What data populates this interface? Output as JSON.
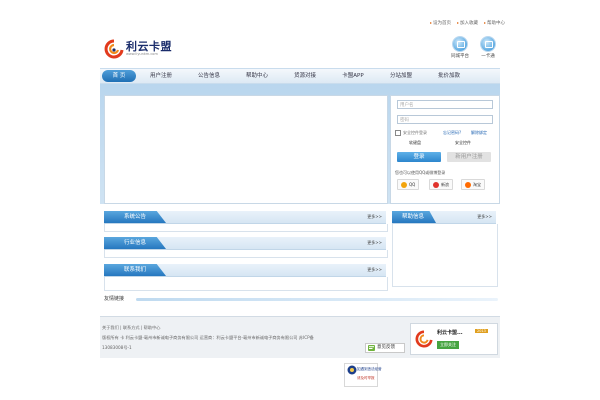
{
  "top_links": [
    "设为首页",
    "加入收藏",
    "帮助中心"
  ],
  "logo": {
    "name": "利云卡盟",
    "url_text": "www.liyunkm.com"
  },
  "top_icons": [
    {
      "label": "同城平台",
      "icon": "monitor-icon"
    },
    {
      "label": "一卡通",
      "icon": "card-icon"
    }
  ],
  "nav": {
    "home": "首 页",
    "items": [
      "用户注册",
      "公告信息",
      "帮助中心",
      "货源对接",
      "卡盟APP",
      "分站加盟",
      "批价加款"
    ]
  },
  "login": {
    "username_placeholder": "用户名",
    "password_placeholder": "密码",
    "remember": "安全控件登录",
    "forgot": "忘记密码?",
    "unlock": "解除绑定",
    "softkeyboard": "软键盘",
    "security_control": "安全控件",
    "login_button": "登录",
    "register_button": "新用户注册",
    "third_party_note": "您也可以使用QQ或微博登录",
    "social": [
      {
        "label": "QQ",
        "icon": "qq-icon",
        "color": "#f2a40d"
      },
      {
        "label": "新浪",
        "icon": "weibo-icon",
        "color": "#e0332c"
      },
      {
        "label": "淘宝",
        "icon": "taobao-icon",
        "color": "#ff6a00"
      }
    ]
  },
  "sections": {
    "notice": {
      "title": "系统公告",
      "more": "更多>>"
    },
    "industry": {
      "title": "行业信息",
      "more": "更多>>"
    },
    "contact": {
      "title": "联系我们",
      "more": "更多>>"
    },
    "help": {
      "title": "帮助信息",
      "more": "更多>>"
    }
  },
  "friendly_links": "友情链接",
  "footer": {
    "links_line": "关于我们 | 联系方式 | 帮助中心",
    "copyright": "版权所有 卡    利云卡盟-亳州市新诚电子商务有限公司    运营商：利云卡盟平台-亳州市新诚电子商务有限公司    苏ICP备",
    "icp": "13083008号-1",
    "feedback": "意见反馈",
    "card_name": "利云卡盟...",
    "card_badge": "2013",
    "card_button": "立即关注"
  },
  "badge_text": [
    "如遇到违法经营",
    "请及时举报"
  ]
}
